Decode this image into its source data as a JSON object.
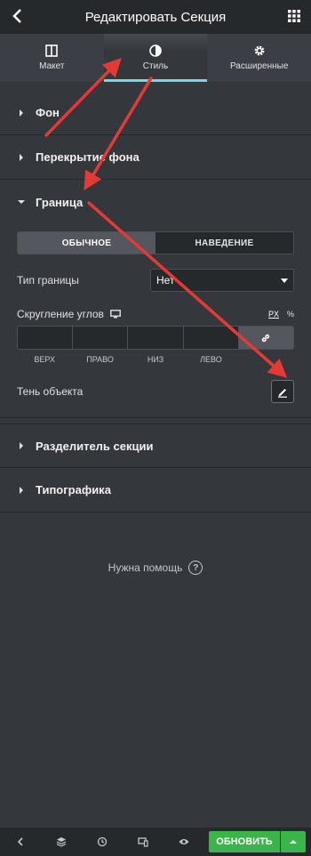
{
  "header": {
    "title": "Редактировать Секция"
  },
  "tabs": [
    {
      "label": "Макет",
      "icon": "layout-icon"
    },
    {
      "label": "Стиль",
      "icon": "contrast-icon",
      "active": true
    },
    {
      "label": "Расширенные",
      "icon": "gear-icon"
    }
  ],
  "sections": {
    "background": "Фон",
    "overlay": "Перекрытие фона",
    "border": "Граница",
    "divider": "Разделитель секции",
    "typography": "Типографика"
  },
  "border": {
    "state_normal": "ОБЫЧНОЕ",
    "state_hover": "НАВЕДЕНИЕ",
    "type_label": "Тип границы",
    "type_value": "Нет",
    "radius_label": "Скругление углов",
    "units": [
      "PX",
      "%"
    ],
    "dims": [
      "ВЕРХ",
      "ПРАВО",
      "НИЗ",
      "ЛЕВО"
    ],
    "shadow_label": "Тень объекта"
  },
  "help": "Нужна помощь",
  "footer": {
    "update_label": "ОБНОВИТЬ"
  },
  "colors": {
    "accent": "#71d7f7",
    "update": "#39b54a",
    "annotation": "#e53935"
  }
}
